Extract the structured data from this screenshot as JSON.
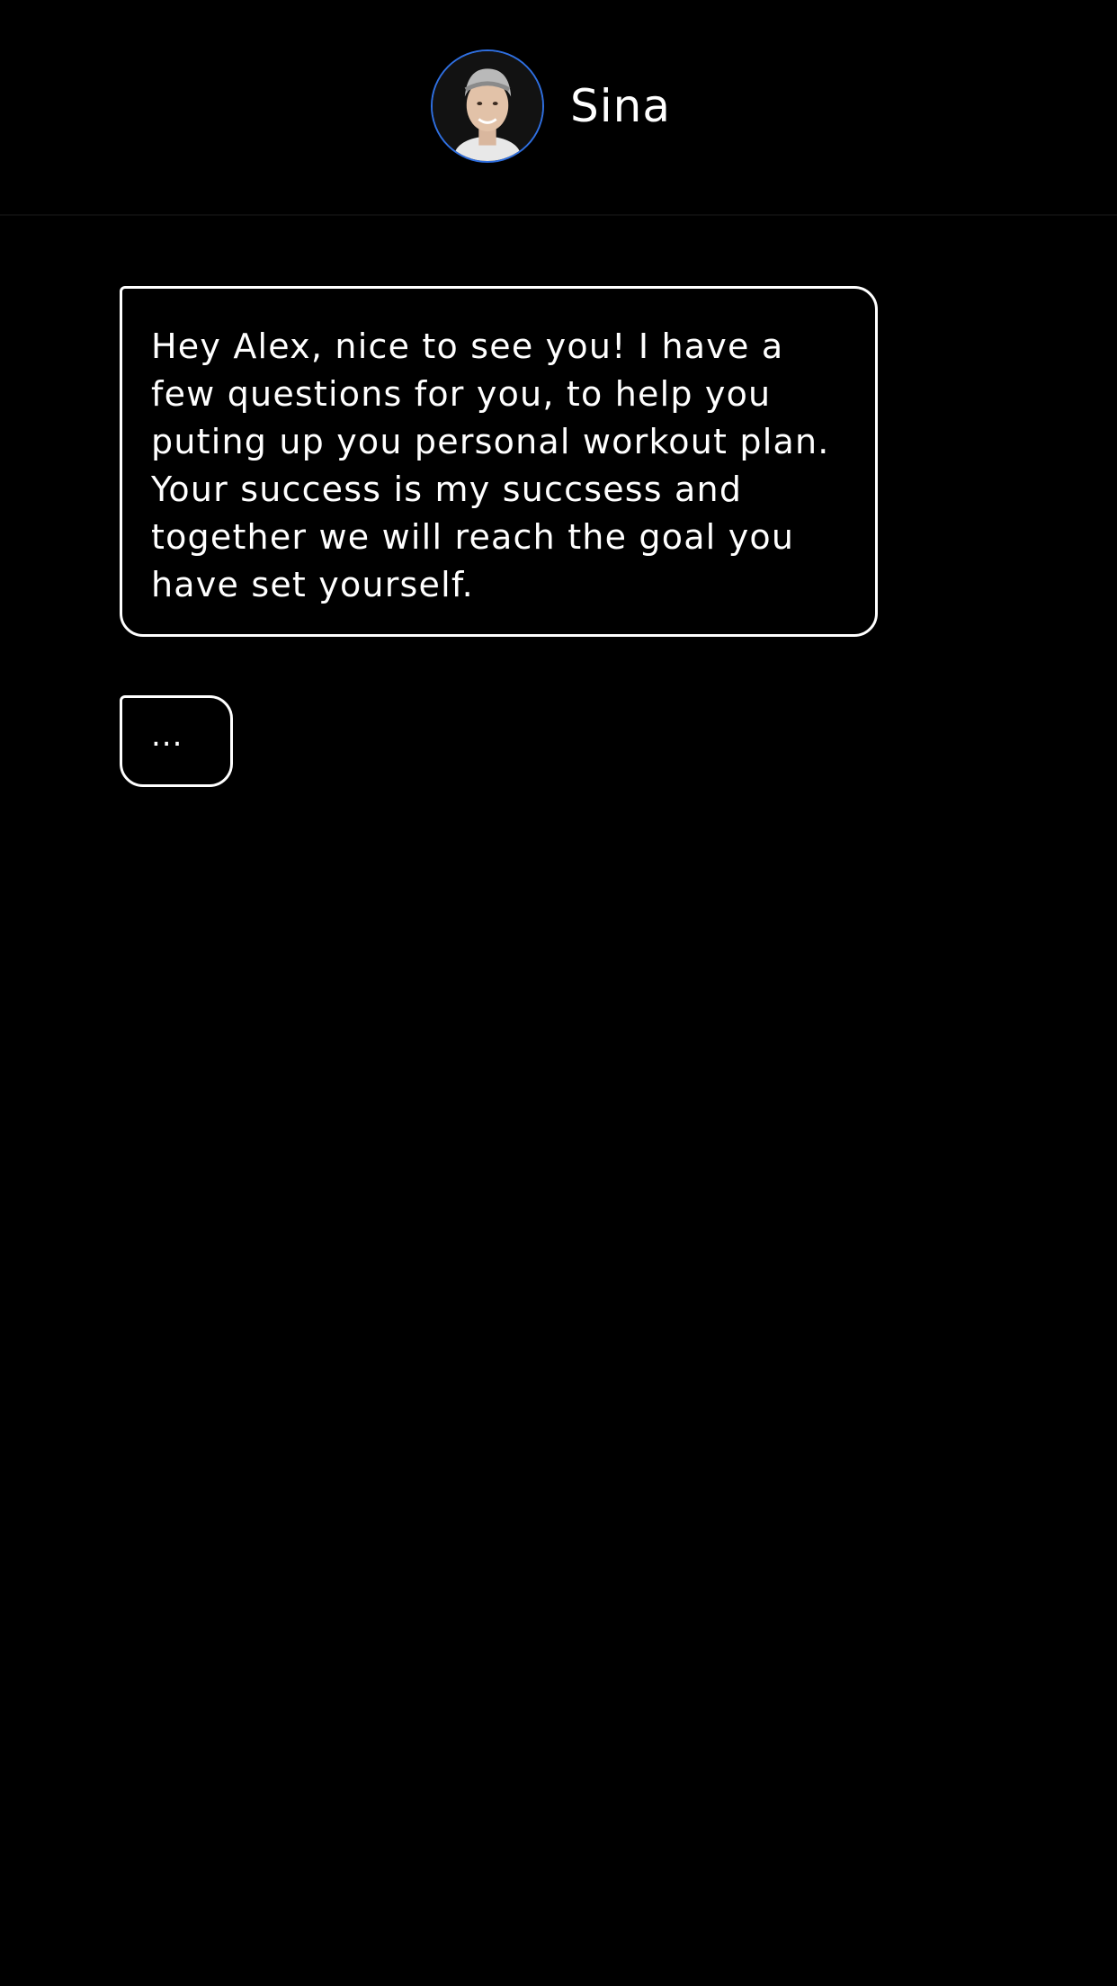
{
  "header": {
    "contact_name": "Sina",
    "avatar_icon": "avatar-photo",
    "avatar_ring_color": "#2f6fe0"
  },
  "chat": {
    "messages": [
      {
        "text": "Hey Alex, nice to see you! I have a few questions for you, to help you puting up you personal workout plan. Your success is my succsess and together we will reach the goal you have set yourself."
      }
    ],
    "typing_indicator": "..."
  },
  "colors": {
    "background": "#000000",
    "text": "#ffffff",
    "bubble_border": "#ffffff"
  }
}
